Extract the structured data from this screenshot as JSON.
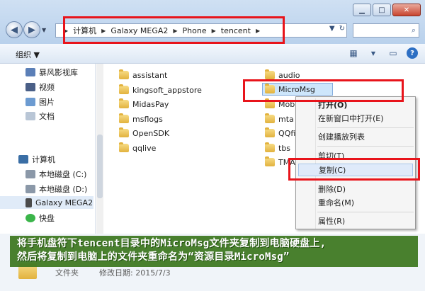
{
  "address_bar": {
    "crumbs": [
      "计算机",
      "Galaxy MEGA2",
      "Phone",
      "tencent"
    ]
  },
  "toolbar": {
    "organize_label": "组织 ▼"
  },
  "nav_pane": {
    "items": [
      {
        "label": "暴风影视库",
        "icon": "video-library-icon"
      },
      {
        "label": "视频",
        "icon": "video-icon"
      },
      {
        "label": "图片",
        "icon": "picture-icon"
      },
      {
        "label": "文档",
        "icon": "document-icon"
      },
      {
        "label": "计算机",
        "icon": "computer-icon"
      },
      {
        "label": "本地磁盘 (C:)",
        "icon": "disk-icon"
      },
      {
        "label": "本地磁盘 (D:)",
        "icon": "disk-icon"
      },
      {
        "label": "Galaxy MEGA2",
        "icon": "phone-icon"
      },
      {
        "label": "快盘",
        "icon": "kuaipan-icon"
      }
    ]
  },
  "files": {
    "left_column": [
      "assistant",
      "kingsoft_appstore",
      "MidasPay",
      "msflogs",
      "OpenSDK",
      "qqlive"
    ],
    "right_column": [
      "audio",
      "MicroMsg",
      "Mobi",
      "mta",
      "QQfil",
      "tbs",
      "TMAs"
    ]
  },
  "context_menu": {
    "items": [
      "打开(O)",
      "在新窗口中打开(E)",
      "创建播放列表",
      "剪切(T)",
      "复制(C)",
      "删除(D)",
      "重命名(M)",
      "属性(R)"
    ]
  },
  "details": {
    "type": "文件夹",
    "modified": "修改日期: 2015/7/3"
  },
  "annotation": {
    "line1": "将手机盘符下tencent目录中的MicroMsg文件夹复制到电脑硬盘上,",
    "line2": "然后将复制到电脑上的文件夹重命名为“资源目录MicroMsg”"
  },
  "colors": {
    "highlight": "#e8141b",
    "banner": "#3c761e"
  }
}
